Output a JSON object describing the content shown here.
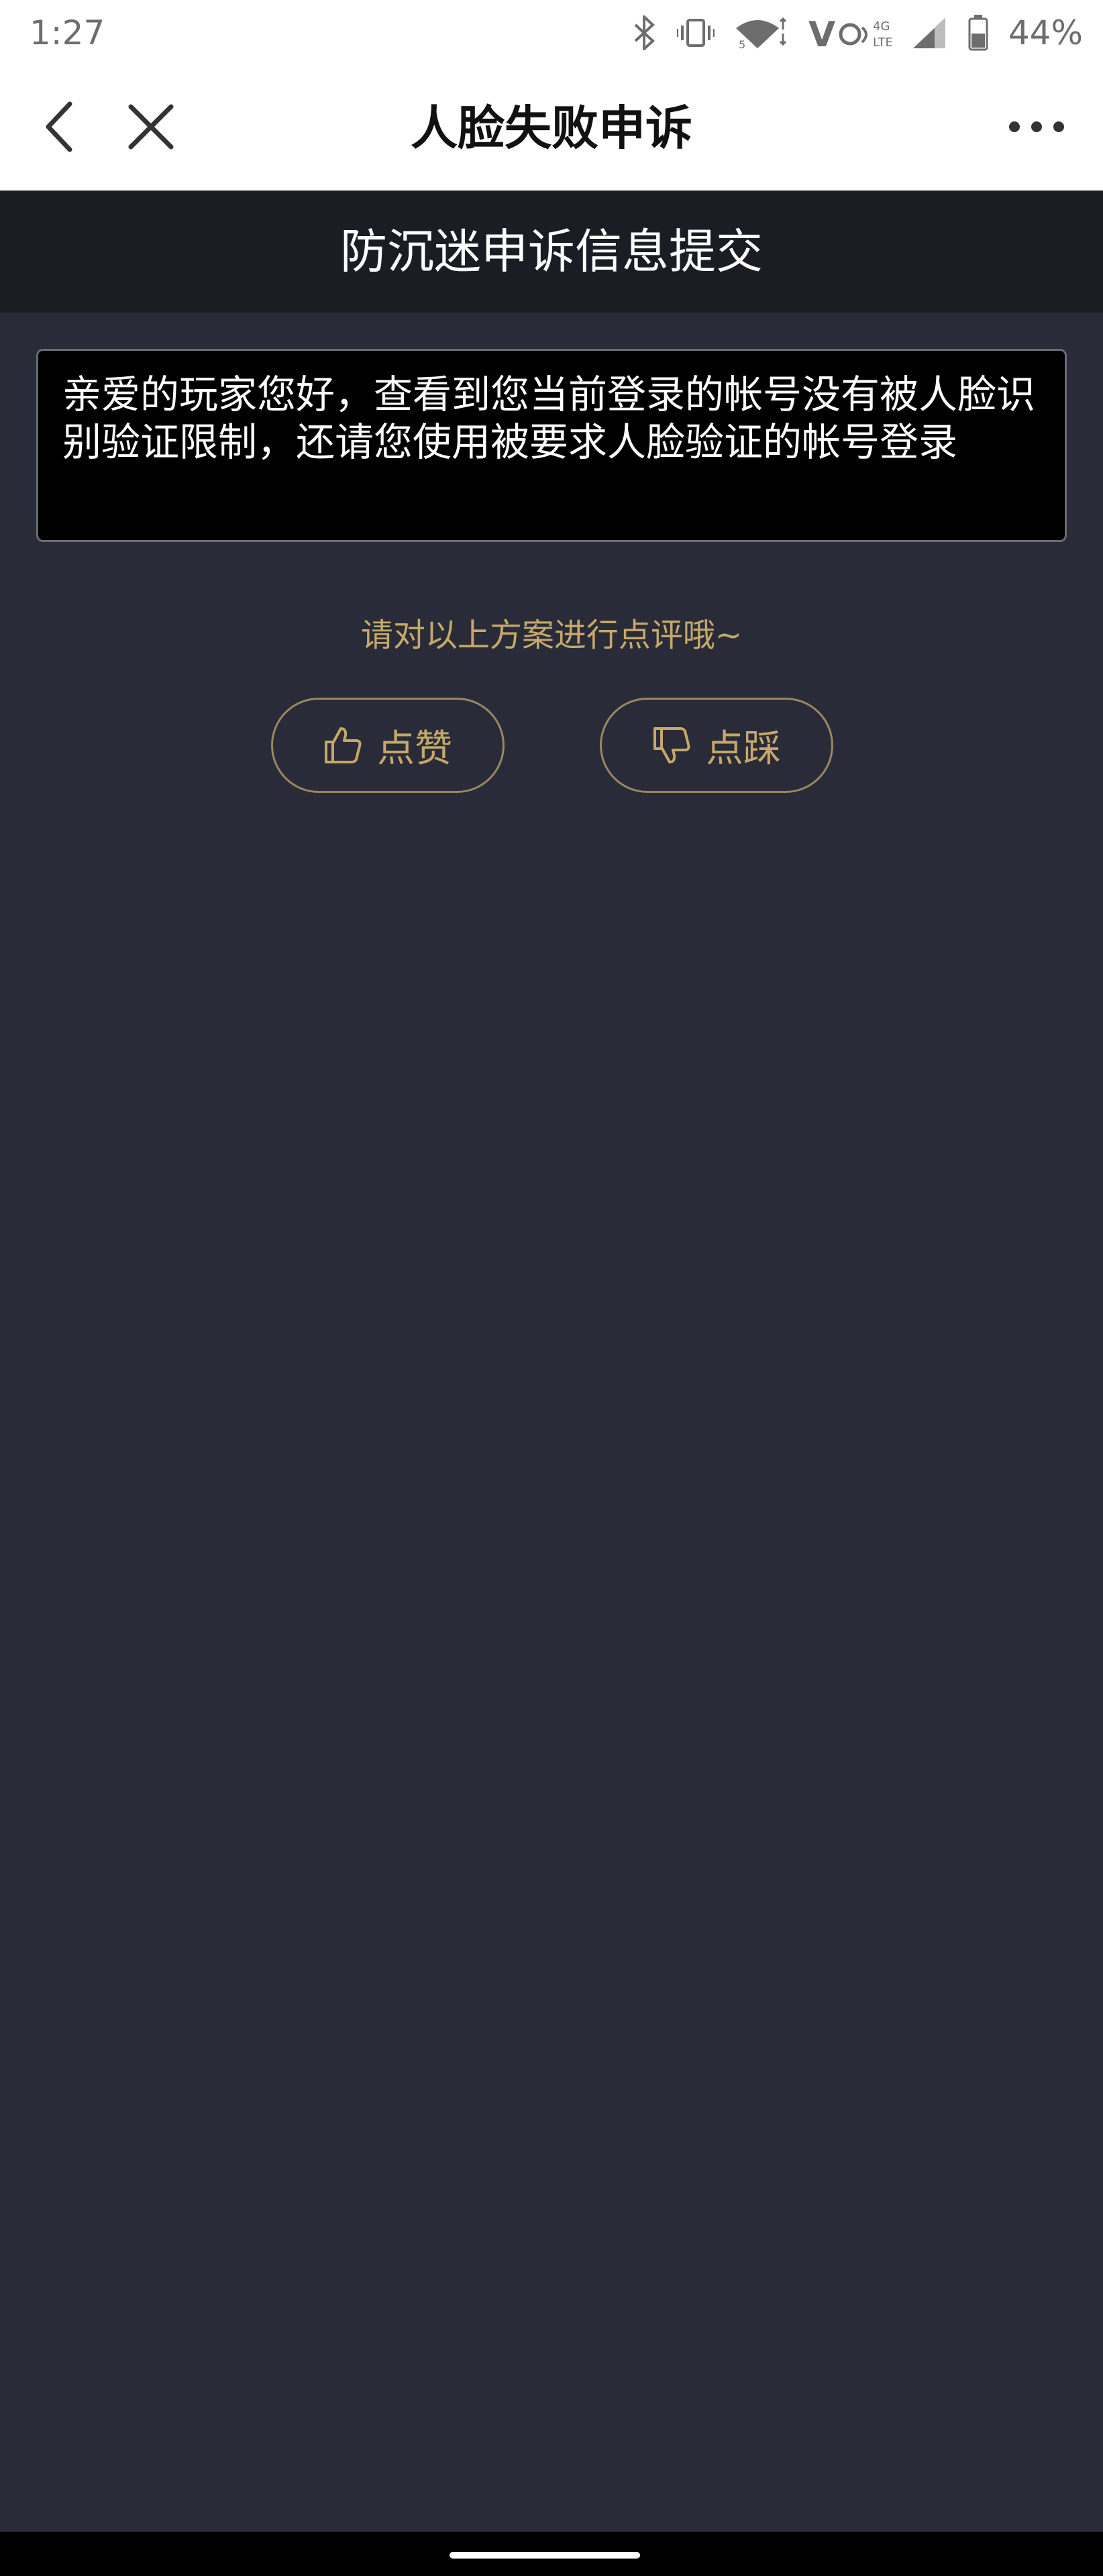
{
  "status_bar": {
    "time": "1:27",
    "battery_percent": "44%",
    "icons": [
      "bluetooth-icon",
      "vibrate-icon",
      "wifi-icon",
      "volte-icon",
      "signal-icon",
      "battery-icon"
    ]
  },
  "nav": {
    "title": "人脸失败申诉",
    "back_icon": "back-chevron-icon",
    "close_icon": "close-icon",
    "more_icon": "more-dots-icon"
  },
  "section_header": {
    "title": "防沉迷申诉信息提交"
  },
  "message": {
    "text": "亲爱的玩家您好，查看到您当前登录的帐号没有被人脸识别验证限制，还请您使用被要求人脸验证的帐号登录"
  },
  "rating": {
    "prompt": "请对以上方案进行点评哦~",
    "like_label": "点赞",
    "dislike_label": "点踩"
  },
  "colors": {
    "background": "#292c38",
    "header_bg": "#1b1d25",
    "accent_gold": "#c5a86a",
    "message_bg": "#000000"
  }
}
